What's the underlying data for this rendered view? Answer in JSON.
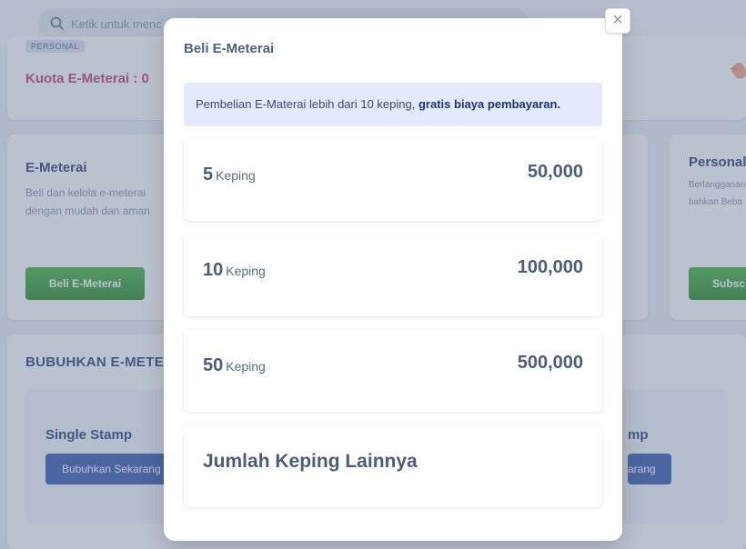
{
  "background": {
    "search_placeholder": "Ketik untuk menc",
    "personal_badge": "PERSONAL",
    "quota_text": "Kuota E-Meterai : 0",
    "emeterai_card": {
      "title": "E-Meterai",
      "description": "Beli dan kelola e-meterai dengan mudah dan aman",
      "button_label": "Beli E-Meterai"
    },
    "personal_card": {
      "title": "Personal",
      "description": "Berlangganan penyimpanan lebih lama d bahkan Beba",
      "button_label": "Subsc"
    },
    "bubuhkan_section": {
      "title": "BUBUHKAN E-METERAI",
      "single_title": "Single Stamp",
      "single_button": "Bubuhkan Sekarang",
      "multi_title_partial": "mp",
      "multi_button_partial": "arang"
    }
  },
  "modal": {
    "title": "Beli E-Meterai",
    "close_icon": "close-icon",
    "notice_text": "Pembelian E-Materai lebih dari 10 keping,",
    "notice_bold": "gratis biaya pembayaran.",
    "options": [
      {
        "qty": "5",
        "unit": "Keping",
        "price": "50,000"
      },
      {
        "qty": "10",
        "unit": "Keping",
        "price": "100,000"
      },
      {
        "qty": "50",
        "unit": "Keping",
        "price": "500,000"
      }
    ],
    "other_option": "Jumlah Keping Lainnya"
  },
  "colors": {
    "accent_green": "#3ea23a",
    "accent_blue": "#3d5fb0",
    "quota_pink": "#c9406f",
    "notice_bg": "#e5e9fd"
  }
}
